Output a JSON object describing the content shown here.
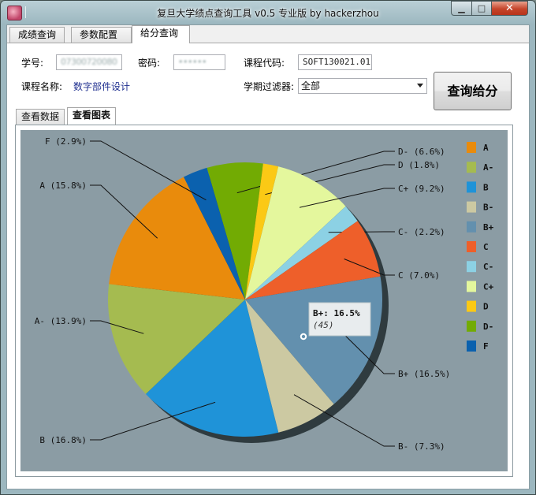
{
  "window": {
    "title": "复旦大学绩点查询工具 v0.5 专业版 by hackerzhou"
  },
  "tabs": [
    {
      "label": "成绩查询"
    },
    {
      "label": "参数配置"
    },
    {
      "label": "给分查询"
    }
  ],
  "form": {
    "student_id_label": "学号:",
    "student_id_value": "07300720080",
    "password_label": "密码:",
    "password_value": "••••••",
    "course_code_label": "课程代码:",
    "course_code_value": "SOFT130021.01",
    "course_name_label": "课程名称:",
    "course_name_value": "数字部件设计",
    "term_filter_label": "学期过滤器:",
    "term_filter_value": "全部",
    "query_button": "查询给分"
  },
  "subtabs": [
    {
      "label": "查看数据"
    },
    {
      "label": "查看图表"
    }
  ],
  "tooltip": {
    "title": "B+: 16.5%",
    "count": "(45)"
  },
  "chart_data": {
    "type": "pie",
    "slices": [
      {
        "name": "A",
        "label": "A (15.8%)",
        "value": 15.8,
        "color": "#e98b0c"
      },
      {
        "name": "A-",
        "label": "A- (13.9%)",
        "value": 13.9,
        "color": "#a5bb50"
      },
      {
        "name": "B",
        "label": "B (16.8%)",
        "value": 16.8,
        "color": "#1f93d8"
      },
      {
        "name": "B-",
        "label": "B- (7.3%)",
        "value": 7.3,
        "color": "#ccc9a2"
      },
      {
        "name": "B+",
        "label": "B+ (16.5%)",
        "value": 16.5,
        "color": "#6390ae"
      },
      {
        "name": "C",
        "label": "C (7.0%)",
        "value": 7.0,
        "color": "#ee5f2a"
      },
      {
        "name": "C-",
        "label": "C- (2.2%)",
        "value": 2.2,
        "color": "#8cd1e4"
      },
      {
        "name": "C+",
        "label": "C+ (9.2%)",
        "value": 9.2,
        "color": "#e4f79d"
      },
      {
        "name": "D",
        "label": "D (1.8%)",
        "value": 1.8,
        "color": "#fbc915"
      },
      {
        "name": "D-",
        "label": "D- (6.6%)",
        "value": 6.6,
        "color": "#72ab03"
      },
      {
        "name": "F",
        "label": "F (2.9%)",
        "value": 2.9,
        "color": "#0b61ae"
      }
    ],
    "legend_order": [
      "A",
      "A-",
      "B",
      "B-",
      "B+",
      "C",
      "C-",
      "C+",
      "D",
      "D-",
      "F"
    ],
    "legend_position": "right"
  }
}
